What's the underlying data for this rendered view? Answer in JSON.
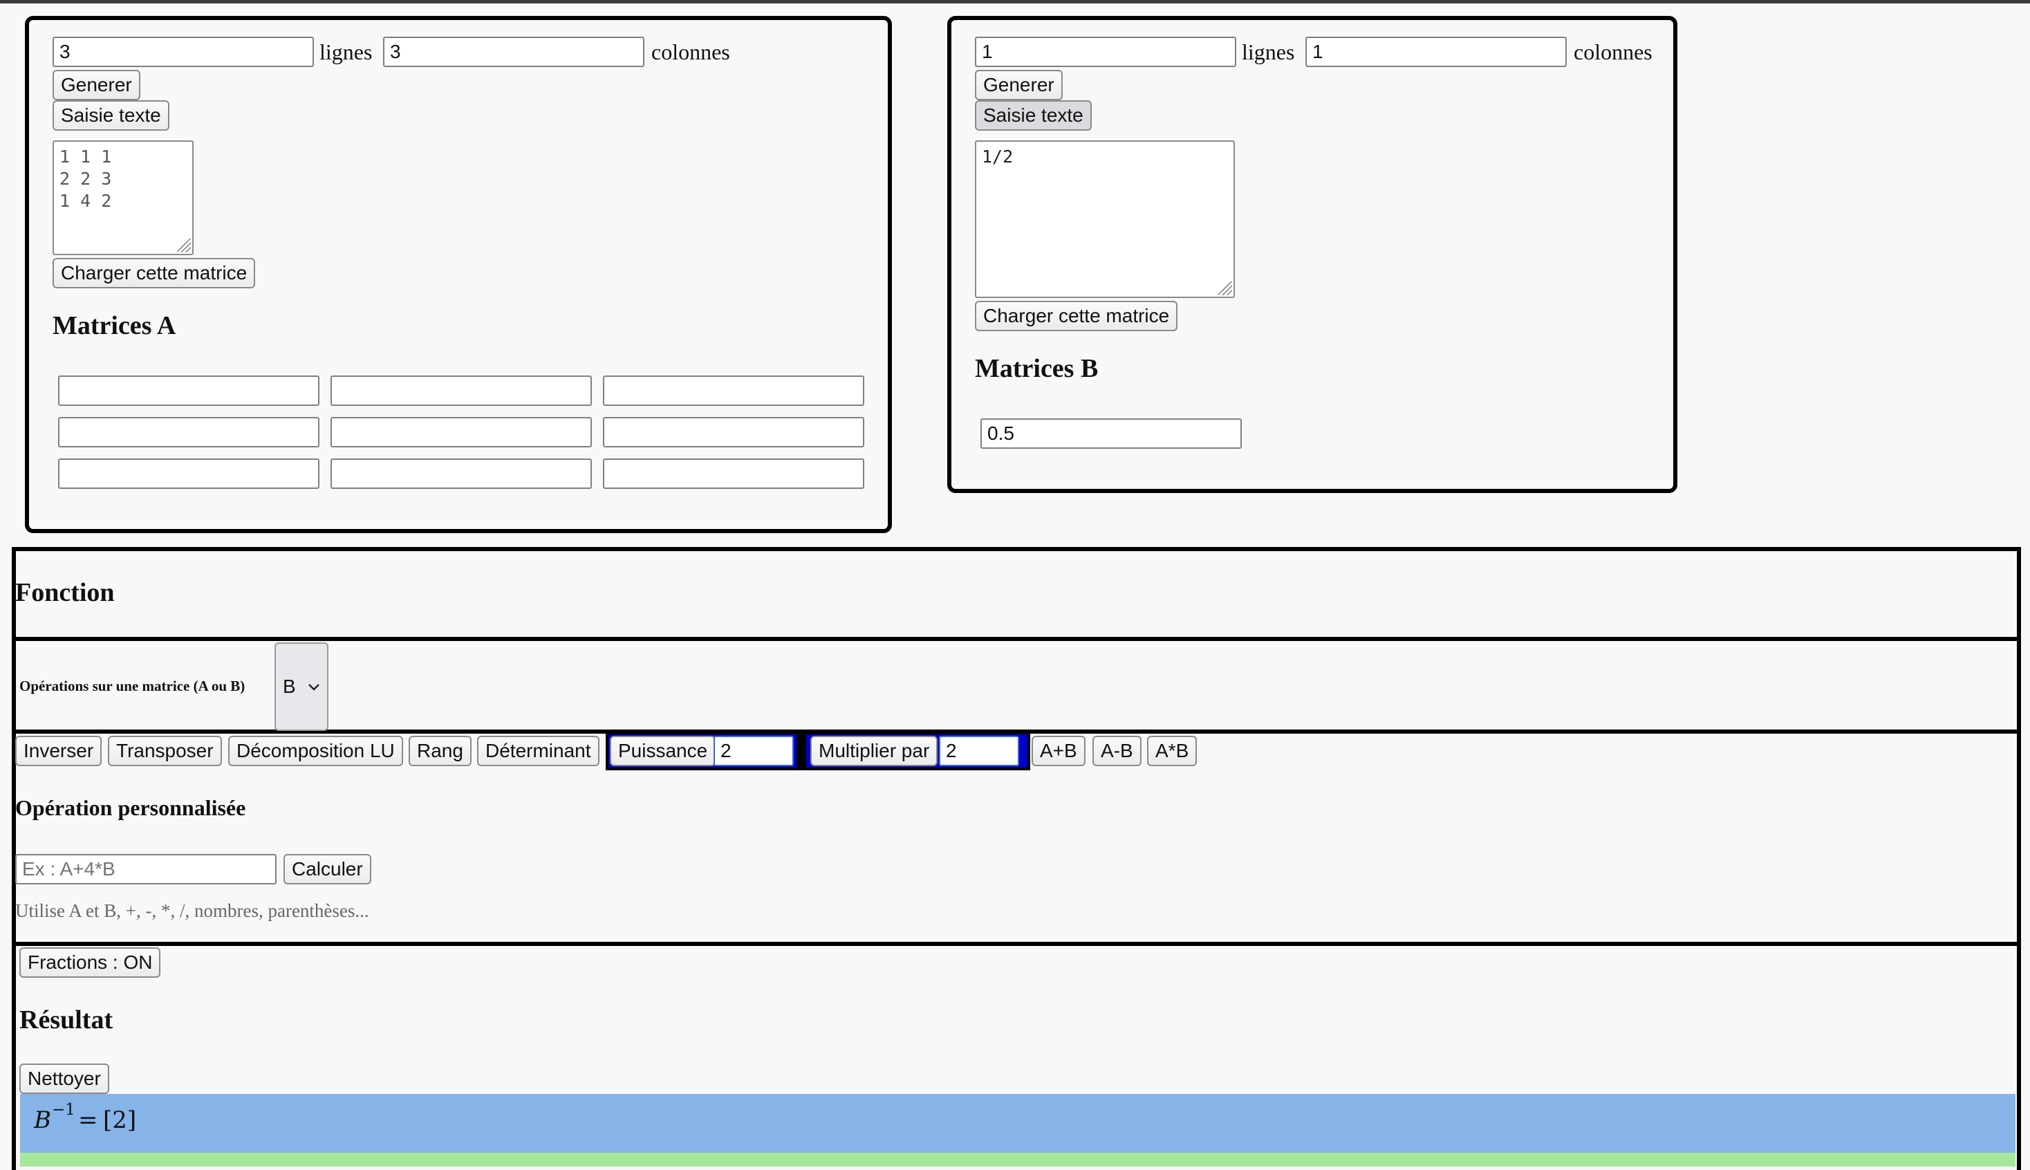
{
  "matrix_a": {
    "rows_value": "3",
    "cols_value": "3",
    "rows_label": "lignes",
    "cols_label": "colonnes",
    "generate_label": "Generer",
    "text_entry_label": "Saisie texte",
    "text_content": "1 1 1\n2 2 3\n1 4 2",
    "load_label": "Charger cette matrice",
    "heading": "Matrices A",
    "cells": [
      [
        "",
        "",
        ""
      ],
      [
        "",
        "",
        ""
      ],
      [
        "",
        "",
        ""
      ]
    ]
  },
  "matrix_b": {
    "rows_value": "1",
    "cols_value": "1",
    "rows_label": "lignes",
    "cols_label": "colonnes",
    "generate_label": "Generer",
    "text_entry_label": "Saisie texte",
    "text_content": "1/2",
    "load_label": "Charger cette matrice",
    "heading": "Matrices B",
    "cells": [
      [
        "0.5"
      ]
    ]
  },
  "fonction": {
    "heading": "Fonction",
    "single_op_label": "Opérations sur une matrice (A ou B)",
    "single_op_selected": "B",
    "ops": {
      "inverse": "Inverser",
      "transpose": "Transposer",
      "lu": "Décomposition LU",
      "rank": "Rang",
      "determinant": "Déterminant",
      "power": "Puissance",
      "power_value": "2",
      "multiply": "Multiplier par",
      "multiply_value": "2",
      "add": "A+B",
      "subtract": "A-B",
      "product": "A*B"
    },
    "custom_heading": "Opération personnalisée",
    "custom_placeholder": "Ex : A+4*B",
    "compute_label": "Calculer",
    "hint": "Utilise A et B, +, -, *, /, nombres, parenthèses..."
  },
  "result": {
    "fractions_label": "Fractions : ON",
    "heading": "Résultat",
    "clear_label": "Nettoyer",
    "entry_base": "B",
    "entry_sup": "−1",
    "entry_eq": "=",
    "entry_value": "[2]"
  },
  "colors": {
    "result_blue": "#87b4e8",
    "result_green": "#a6e79b",
    "group_blue": "#0000c8"
  }
}
